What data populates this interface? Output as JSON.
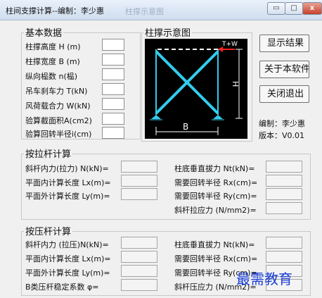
{
  "window": {
    "title": "柱间支撑计算--编制：李少惠",
    "faded_text": "柱撑示意图",
    "controls": {
      "minimize": "▭",
      "maximize": "□",
      "close": "x"
    }
  },
  "basic": {
    "title": "基本数据",
    "fields": [
      {
        "label": "柱撑高度 H (m)",
        "value": ""
      },
      {
        "label": "柱撑宽度 B (m)",
        "value": ""
      },
      {
        "label": "纵向榀数 n(榀)",
        "value": ""
      },
      {
        "label": "吊车刹车力 T(kN)",
        "value": ""
      },
      {
        "label": "风荷载合力 W(kN)",
        "value": ""
      },
      {
        "label": "验算截面积A(cm2)",
        "value": ""
      },
      {
        "label": "验算回转半径i(cm)",
        "value": ""
      }
    ]
  },
  "diagram": {
    "title": "柱撑示意图",
    "load_label": "T+W",
    "h_label": "H",
    "b_label": "B",
    "colors": {
      "background": "#000000",
      "brace": "#33ccee",
      "load": "#ff2020",
      "dim": "#ffffff"
    }
  },
  "buttons": {
    "show_result": "显示结果",
    "about": "关于本软件",
    "close_exit": "关闭退出"
  },
  "info": {
    "author": "编制：李少惠",
    "version": "版本：V0.01"
  },
  "tension": {
    "title": "按拉杆计算",
    "left": [
      {
        "label": "斜杆内力(拉力) N(kN)=",
        "value": ""
      },
      {
        "label": "平面内计算长度 Lx(m)=",
        "value": ""
      },
      {
        "label": "平面外计算长度 Ly(m)=",
        "value": ""
      }
    ],
    "right": [
      {
        "label": "柱底垂直拔力 Nt(kN)=",
        "value": ""
      },
      {
        "label": "需要回转半径 Rx(cm)=",
        "value": ""
      },
      {
        "label": "需要回转半径 Ry(cm)=",
        "value": ""
      },
      {
        "label": "斜杆拉应力 (N/mm2)=",
        "value": ""
      }
    ]
  },
  "compression": {
    "title": "按压杆计算",
    "left": [
      {
        "label": "斜杆内力 (拉压)N(kN)=",
        "value": ""
      },
      {
        "label": "平面内计算长度 Lx(m)=",
        "value": ""
      },
      {
        "label": "平面外计算长度 Ly(m)=",
        "value": ""
      },
      {
        "label": "B类压杆稳定系数  φ=",
        "value": ""
      }
    ],
    "right": [
      {
        "label": "柱底垂直拔力 Nt(kN)=",
        "value": ""
      },
      {
        "label": "需要回转半径 Rx(cm)=",
        "value": ""
      },
      {
        "label": "需要回转半径 Ry(cm)=",
        "value": ""
      },
      {
        "label": "斜杆压应力 (N/mm2)=",
        "value": ""
      }
    ]
  },
  "watermark": "最需教育"
}
